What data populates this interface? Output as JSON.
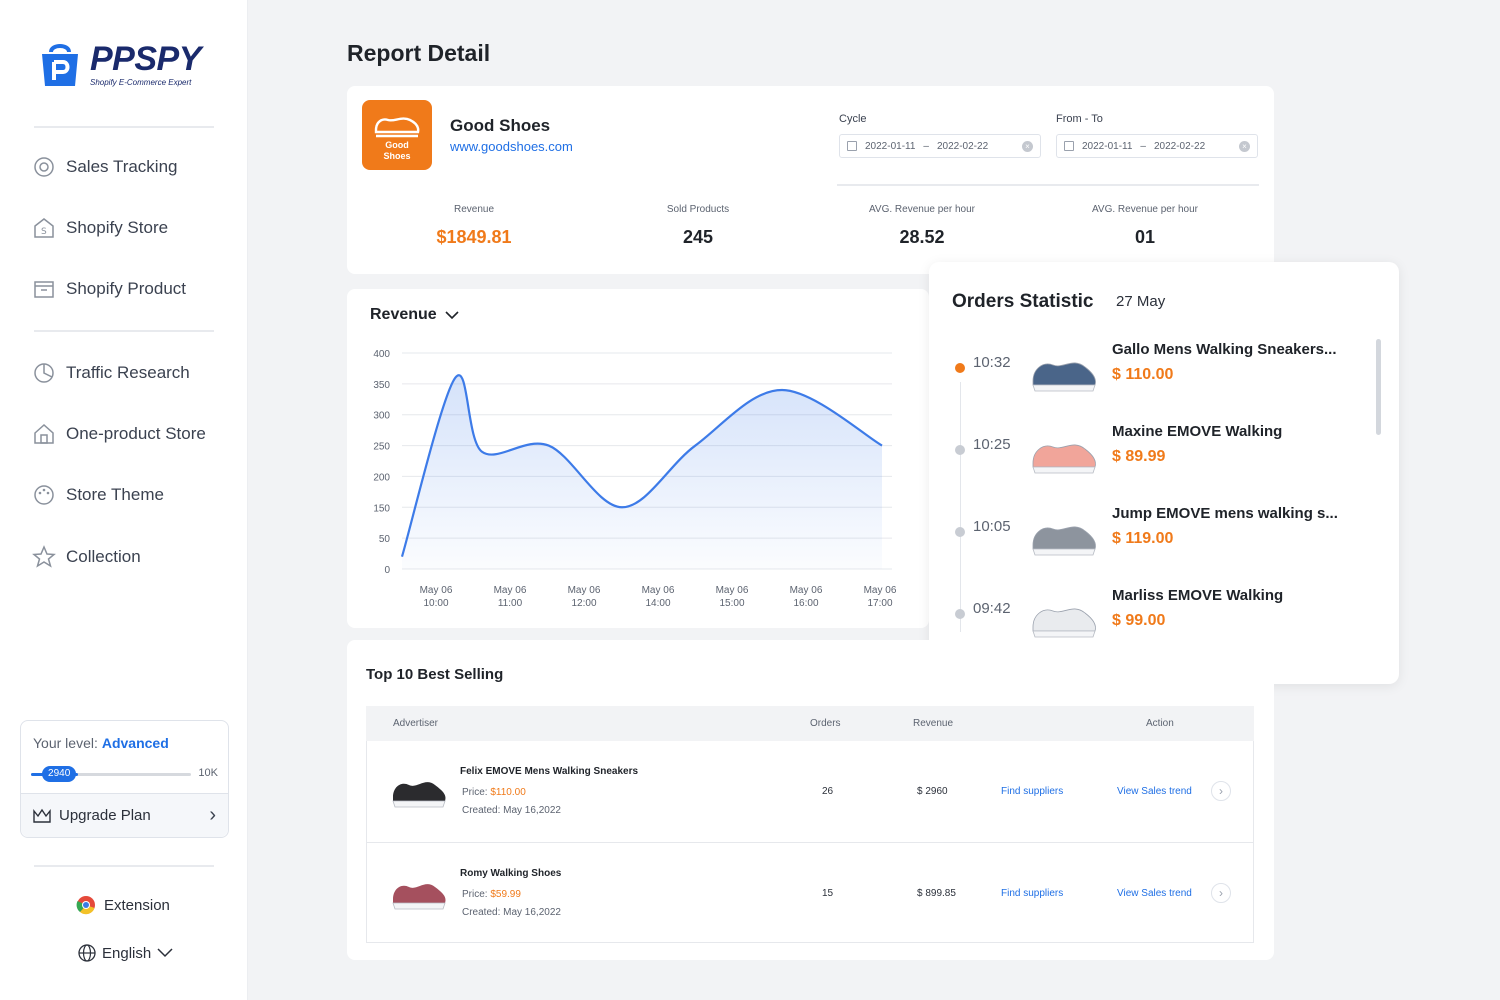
{
  "brand": {
    "name_pp": "PP",
    "name_spy": "SPY",
    "tagline": "Shopify E-Commerce Expert"
  },
  "sidebar": {
    "items": [
      {
        "label": "Sales Tracking",
        "icon": "target-icon"
      },
      {
        "label": "Shopify Store",
        "icon": "store-icon"
      },
      {
        "label": "Shopify Product",
        "icon": "box-icon"
      },
      {
        "label": "Traffic Research",
        "icon": "pie-chart-icon"
      },
      {
        "label": "One-product Store",
        "icon": "home-icon"
      },
      {
        "label": "Store Theme",
        "icon": "palette-icon"
      },
      {
        "label": "Collection",
        "icon": "star-icon"
      }
    ],
    "level": {
      "prefix": "Your level:",
      "value": "Advanced",
      "progress_value": "2940",
      "progress_max": "10K",
      "progress_fraction": 0.294
    },
    "upgrade_label": "Upgrade Plan",
    "extension_label": "Extension",
    "language_label": "English"
  },
  "page_title": "Report Detail",
  "store": {
    "logo_text_1": "Good",
    "logo_text_2": "Shoes",
    "name": "Good Shoes",
    "url": "www.goodshoes.com",
    "cycle_label": "Cycle",
    "cycle_start": "2022-01-11",
    "cycle_end": "2022-02-22",
    "range_label": "From - To",
    "range_start": "2022-01-11",
    "range_end": "2022-02-22",
    "range_sep": "–"
  },
  "metrics": [
    {
      "label": "Revenue",
      "value": "$1849.81"
    },
    {
      "label": "Sold Products",
      "value": "245"
    },
    {
      "label": "AVG. Revenue per hour",
      "value": "28.52"
    },
    {
      "label": "AVG. Revenue per hour",
      "value": "01"
    }
  ],
  "chart_data": {
    "type": "area",
    "title": "Revenue",
    "y_ticks": [
      0,
      50,
      150,
      200,
      250,
      300,
      350,
      400
    ],
    "x_labels": [
      [
        "May 06",
        "10:00"
      ],
      [
        "May 06",
        "11:00"
      ],
      [
        "May 06",
        "12:00"
      ],
      [
        "May 06",
        "14:00"
      ],
      [
        "May 06",
        "15:00"
      ],
      [
        "May 06",
        "16:00"
      ],
      [
        "May 06",
        "17:00"
      ]
    ],
    "series": [
      {
        "values": [
          20,
          360,
          240,
          250,
          150,
          250,
          340,
          250
        ]
      }
    ],
    "x": [
      10.0,
      10.8,
      11.2,
      12.2,
      13.3,
      14.4,
      15.7,
      17.2
    ],
    "ylim": [
      0,
      400
    ],
    "color": "#3d7be8"
  },
  "orders": {
    "title": "Orders Statistic",
    "date": "27 May",
    "items": [
      {
        "time": "10:32",
        "name": "Gallo Mens Walking Sneakers...",
        "price": "$ 110.00",
        "active": true,
        "shoe_color": "#4a6589"
      },
      {
        "time": "10:25",
        "name": "Maxine EMOVE Walking",
        "price": "$ 89.99",
        "active": false,
        "shoe_color": "#f1a59a"
      },
      {
        "time": "10:05",
        "name": "Jump EMOVE mens walking s...",
        "price": "$ 119.00",
        "active": false,
        "shoe_color": "#8d949e"
      },
      {
        "time": "09:42",
        "name": "Marliss EMOVE Walking",
        "price": "$ 99.00",
        "active": false,
        "shoe_color": "#e9ebee"
      }
    ]
  },
  "best_selling": {
    "title": "Top 10 Best Selling",
    "columns": [
      "Advertiser",
      "Orders",
      "Revenue",
      "Action"
    ],
    "rows": [
      {
        "name": "Felix EMOVE Mens Walking Sneakers",
        "price_label": "Price:",
        "price": "$110.00",
        "created_label": "Created:",
        "created": "May 16,2022",
        "orders": "26",
        "revenue": "$ 2960",
        "find": "Find suppliers",
        "trend": "View Sales trend",
        "shoe_color": "#2b2b2e"
      },
      {
        "name": "Romy Walking Shoes",
        "price_label": "Price:",
        "price": "$59.99",
        "created_label": "Created:",
        "created": "May 16,2022",
        "orders": "15",
        "revenue": "$ 899.85",
        "find": "Find suppliers",
        "trend": "View Sales trend",
        "shoe_color": "#a5505e"
      }
    ]
  }
}
